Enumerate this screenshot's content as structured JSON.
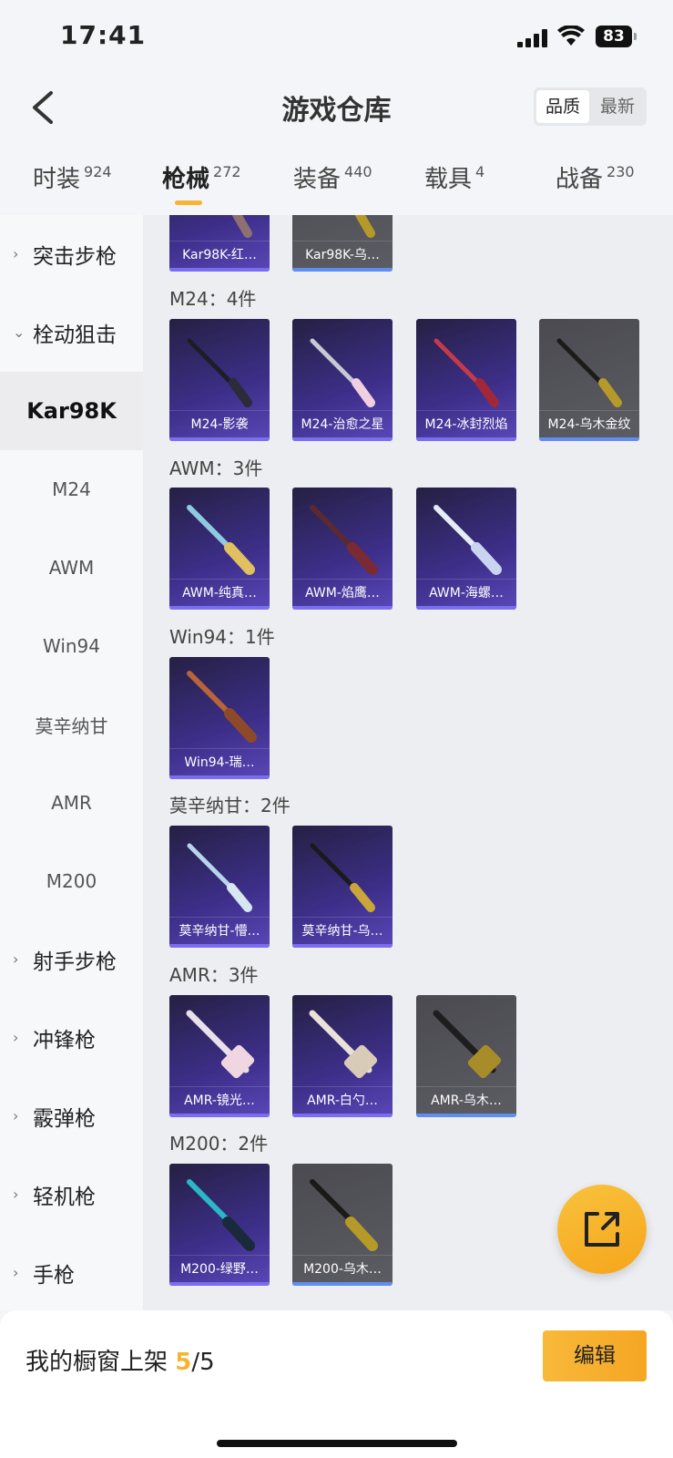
{
  "status": {
    "time": "17:41",
    "battery": "83"
  },
  "header": {
    "title": "游戏仓库",
    "sort_quality": "品质",
    "sort_newest": "最新"
  },
  "tabs": [
    {
      "label": "时装",
      "count": "924"
    },
    {
      "label": "枪械",
      "count": "272"
    },
    {
      "label": "装备",
      "count": "440"
    },
    {
      "label": "载具",
      "count": "4"
    },
    {
      "label": "战备",
      "count": "230"
    }
  ],
  "sidebar": {
    "items": [
      {
        "label": "突击步枪"
      },
      {
        "label": "栓动狙击"
      },
      {
        "label": "Kar98K"
      },
      {
        "label": "M24"
      },
      {
        "label": "AWM"
      },
      {
        "label": "Win94"
      },
      {
        "label": "莫辛纳甘"
      },
      {
        "label": "AMR"
      },
      {
        "label": "M200"
      },
      {
        "label": "射手步枪"
      },
      {
        "label": "冲锋枪"
      },
      {
        "label": "霰弹枪"
      },
      {
        "label": "轻机枪"
      },
      {
        "label": "手枪"
      }
    ]
  },
  "sections": [
    {
      "title": "",
      "items": [
        {
          "name": "Kar98K-红…"
        },
        {
          "name": "Kar98K-乌…"
        }
      ]
    },
    {
      "title": "M24：4件",
      "items": [
        {
          "name": "M24-影袭"
        },
        {
          "name": "M24-治愈之星"
        },
        {
          "name": "M24-冰封烈焰"
        },
        {
          "name": "M24-乌木金纹"
        }
      ]
    },
    {
      "title": "AWM：3件",
      "items": [
        {
          "name": "AWM-纯真…"
        },
        {
          "name": "AWM-焰鹰…"
        },
        {
          "name": "AWM-海螺…"
        }
      ]
    },
    {
      "title": "Win94：1件",
      "items": [
        {
          "name": "Win94-瑞…"
        }
      ]
    },
    {
      "title": "莫辛纳甘：2件",
      "items": [
        {
          "name": "莫辛纳甘-懵…"
        },
        {
          "name": "莫辛纳甘-乌…"
        }
      ]
    },
    {
      "title": "AMR：3件",
      "items": [
        {
          "name": "AMR-镜光…"
        },
        {
          "name": "AMR-白勺…"
        },
        {
          "name": "AMR-乌木…"
        }
      ]
    },
    {
      "title": "M200：2件",
      "items": [
        {
          "name": "M200-绿野…"
        },
        {
          "name": "M200-乌木…"
        }
      ]
    }
  ],
  "footer": {
    "label": "我的橱窗上架",
    "current": "5",
    "total": "/5",
    "edit_label": "编辑"
  }
}
